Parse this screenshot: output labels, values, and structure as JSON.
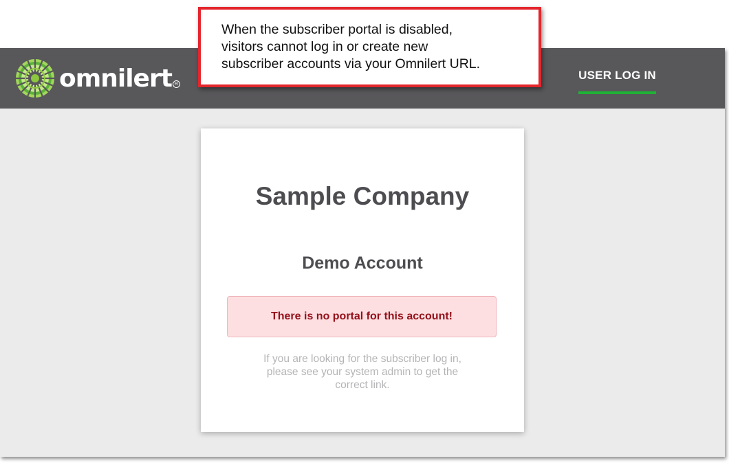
{
  "brand": {
    "name": "omnilert",
    "registered_mark": "R",
    "colors": {
      "green": "#8dc63f",
      "dark_green": "#1fb135",
      "navbar": "#58575a"
    }
  },
  "nav": {
    "login_label": "USER LOG IN"
  },
  "card": {
    "company": "Sample Company",
    "account": "Demo Account",
    "alert": "There is no portal for this account!",
    "help_lines": [
      "If you are looking for the subscriber log in,",
      "please see your system admin to get the",
      "correct link."
    ]
  },
  "callout": {
    "lines": [
      "When the subscriber portal is disabled,",
      "visitors cannot log in or create new",
      "subscriber accounts via your Omnilert URL."
    ],
    "border_color": "#e3262c"
  }
}
